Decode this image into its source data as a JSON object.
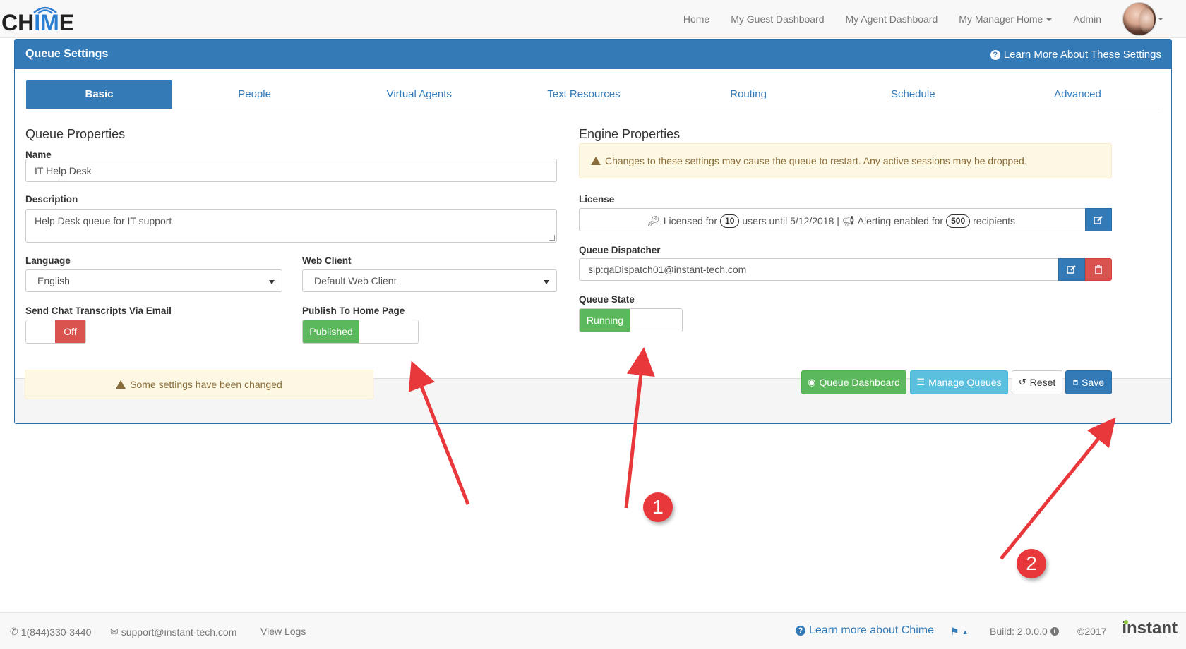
{
  "navbar": {
    "logo_prefix": "CH",
    "logo_accent": "IM",
    "logo_suffix": "E",
    "links": [
      "Home",
      "My Guest Dashboard",
      "My Agent Dashboard",
      "My Manager Home",
      "Admin"
    ]
  },
  "panel": {
    "title": "Queue Settings",
    "help_link": "Learn More About These Settings"
  },
  "tabs": [
    "Basic",
    "People",
    "Virtual Agents",
    "Text Resources",
    "Routing",
    "Schedule",
    "Advanced"
  ],
  "queue_properties": {
    "heading": "Queue Properties",
    "name_label": "Name",
    "name_value": "IT Help Desk",
    "description_label": "Description",
    "description_value": "Help Desk queue for IT support",
    "language_label": "Language",
    "language_value": "English",
    "web_client_label": "Web Client",
    "web_client_value": "Default Web Client",
    "transcripts_label": "Send Chat Transcripts Via Email",
    "transcripts_state": "Off",
    "publish_label": "Publish To Home Page",
    "publish_state": "Published"
  },
  "engine_properties": {
    "heading": "Engine Properties",
    "warning": "Changes to these settings may cause the queue to restart. Any active sessions may be dropped.",
    "license_label": "License",
    "license": {
      "prefix": "Licensed for",
      "users": "10",
      "middle": "users until 5/12/2018 |",
      "alerting": "Alerting enabled for",
      "recipients": "500",
      "suffix": "recipients"
    },
    "dispatcher_label": "Queue Dispatcher",
    "dispatcher_value": "sip:qaDispatch01@instant-tech.com",
    "state_label": "Queue State",
    "state_value": "Running"
  },
  "footer_bar": {
    "changed_notice": "Some settings have been changed",
    "buttons": {
      "dashboard": "Queue Dashboard",
      "manage": "Manage Queues",
      "reset": "Reset",
      "save": "Save"
    }
  },
  "page_footer": {
    "phone": "1(844)330-3440",
    "email": "support@instant-tech.com",
    "view_logs": "View Logs",
    "learn_more": "Learn more about Chime",
    "build": "Build: 2.0.0.0",
    "copyright": "©2017",
    "brand": "instant"
  },
  "annotations": {
    "marker_1": "1",
    "marker_2": "2",
    "arrow_color": "#e8383b"
  }
}
